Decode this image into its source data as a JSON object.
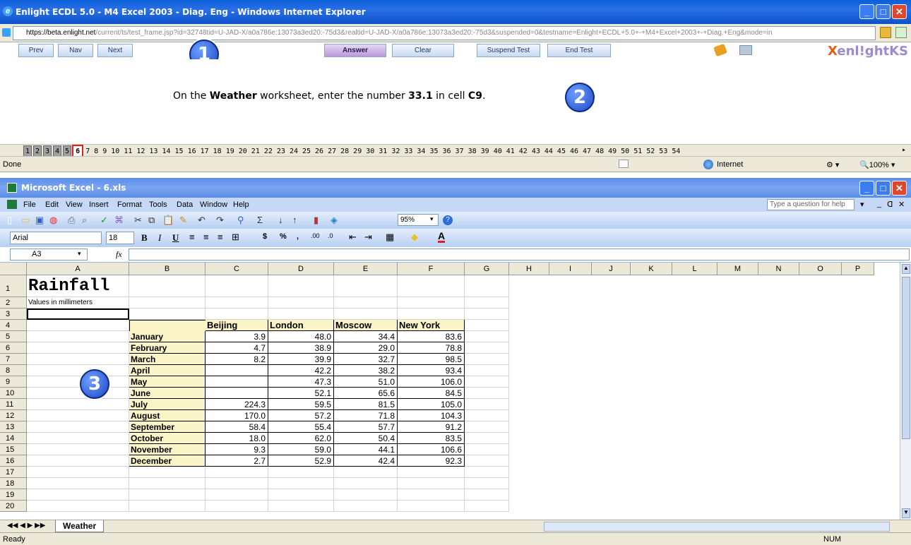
{
  "ie": {
    "title": "Enlight ECDL 5.0 - M4 Excel 2003 - Diag. Eng - Windows Internet Explorer",
    "url_prefix": "https://",
    "url_host": "beta.enlight.net",
    "url_rest": "/current/ts/test_frame.jsp?id=32748tid=U-JAD-X/a0a786e:13073a3ed20:-75d3&realtid=U-JAD-X/a0a786e:13073a3ed20:-75d3&suspended=0&testname=Enlight+ECDL+5.0+-+M4+Excel+2003+-+Diag.+Eng&mode=in",
    "status_left": "Done",
    "zone": "Internet",
    "zoom": "100%"
  },
  "toolbar": {
    "prev": "Prev",
    "nav": "Nav",
    "next": "Next",
    "answer": "Answer",
    "clear": "Clear",
    "suspend": "Suspend Test",
    "end": "End Test",
    "brand": "enl!ghtKS",
    "brand_prefix": "X"
  },
  "callouts": [
    "1",
    "2",
    "3"
  ],
  "question": {
    "pre": "On the ",
    "sheet": "Weather",
    "mid": " worksheet, enter the number ",
    "value": "33.1",
    "mid2": " in cell ",
    "cell": "C9",
    "post": "."
  },
  "question_numbers": [
    "1",
    "2",
    "3",
    "4",
    "5",
    "6",
    "7",
    "8",
    "9",
    "10",
    "11",
    "12",
    "13",
    "14",
    "15",
    "16",
    "17",
    "18",
    "19",
    "20",
    "21",
    "22",
    "23",
    "24",
    "25",
    "26",
    "27",
    "28",
    "29",
    "30",
    "31",
    "32",
    "33",
    "34",
    "35",
    "36",
    "37",
    "38",
    "39",
    "40",
    "41",
    "42",
    "43",
    "44",
    "45",
    "46",
    "47",
    "48",
    "49",
    "50",
    "51",
    "52",
    "53",
    "54"
  ],
  "answered_count": 5,
  "current_question": "6",
  "excel": {
    "title": "Microsoft Excel - 6.xls",
    "menus": [
      "File",
      "Edit",
      "View",
      "Insert",
      "Format",
      "Tools",
      "Data",
      "Window",
      "Help"
    ],
    "help_placeholder": "Type a question for help",
    "zoom": "95%",
    "font": "Arial",
    "font_size": "18",
    "namebox": "A3",
    "fx": "fx",
    "columns": [
      "A",
      "B",
      "C",
      "D",
      "E",
      "F",
      "G",
      "H",
      "I",
      "J",
      "K",
      "L",
      "M",
      "N",
      "O",
      "P"
    ],
    "rows": [
      "1",
      "2",
      "3",
      "4",
      "5",
      "6",
      "7",
      "8",
      "9",
      "10",
      "11",
      "12",
      "13",
      "14",
      "15",
      "16",
      "17",
      "18",
      "19",
      "20"
    ],
    "sheet_title": "Rainfall",
    "subtitle": "Values in millimeters",
    "headers": [
      "Beijing",
      "London",
      "Moscow",
      "New York"
    ],
    "data": [
      [
        "January",
        "3.9",
        "48.0",
        "34.4",
        "83.6"
      ],
      [
        "February",
        "4.7",
        "38.9",
        "29.0",
        "78.8"
      ],
      [
        "March",
        "8.2",
        "39.9",
        "32.7",
        "98.5"
      ],
      [
        "April",
        "",
        "42.2",
        "38.2",
        "93.4"
      ],
      [
        "May",
        "",
        "47.3",
        "51.0",
        "106.0"
      ],
      [
        "June",
        "",
        "52.1",
        "65.6",
        "84.5"
      ],
      [
        "July",
        "224.3",
        "59.5",
        "81.5",
        "105.0"
      ],
      [
        "August",
        "170.0",
        "57.2",
        "71.8",
        "104.3"
      ],
      [
        "September",
        "58.4",
        "55.4",
        "57.7",
        "91.2"
      ],
      [
        "October",
        "18.0",
        "62.0",
        "50.4",
        "83.5"
      ],
      [
        "November",
        "9.3",
        "59.0",
        "44.1",
        "106.6"
      ],
      [
        "December",
        "2.7",
        "52.9",
        "42.4",
        "92.3"
      ]
    ],
    "sheet_tab": "Weather",
    "status": "Ready",
    "num": "NUM"
  }
}
